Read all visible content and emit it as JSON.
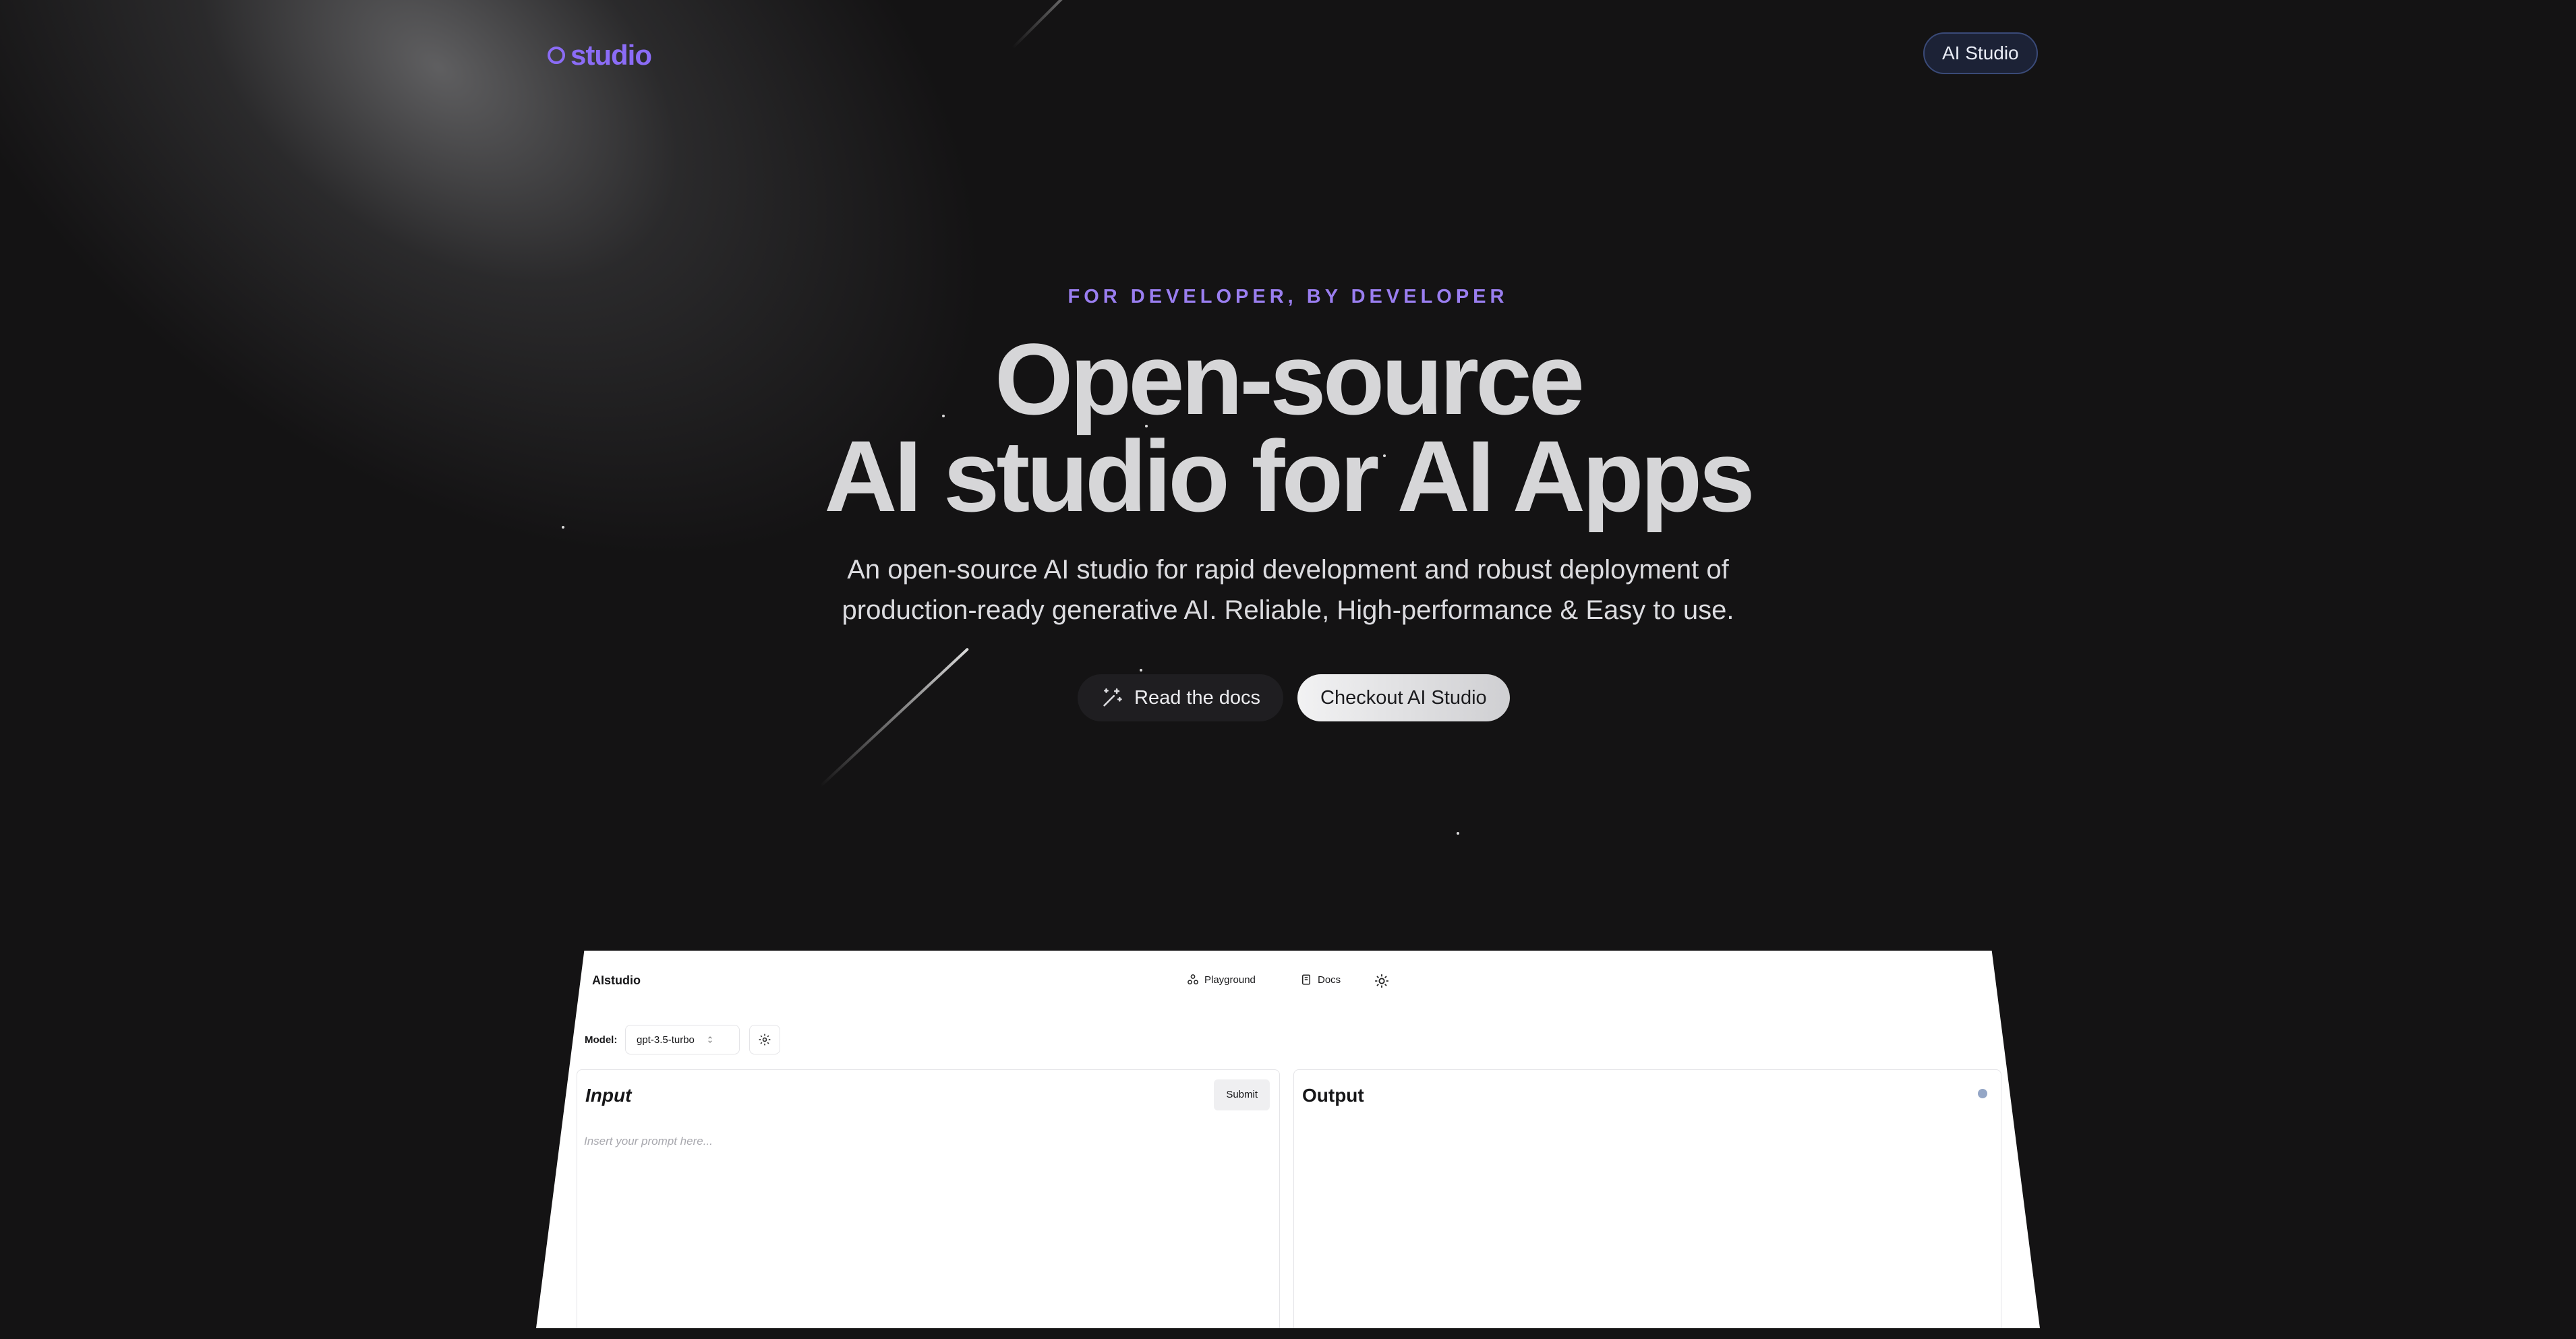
{
  "header": {
    "logo_text": "studio",
    "nav_button": "AI Studio"
  },
  "hero": {
    "eyebrow": "FOR DEVELOPER, BY DEVELOPER",
    "headline_line1": "Open-source",
    "headline_line2": "AI studio for AI Apps",
    "subhead_line1": "An open-source AI studio for rapid development and robust deployment of",
    "subhead_line2": "production-ready generative AI. Reliable, High-performance & Easy to use.",
    "docs_button": "Read the docs",
    "checkout_button": "Checkout AI Studio"
  },
  "preview": {
    "brand": "AIstudio",
    "nav_playground": "Playground",
    "nav_docs": "Docs",
    "model_label": "Model:",
    "model_value": "gpt-3.5-turbo",
    "input_title": "Input",
    "submit_label": "Submit",
    "input_placeholder": "Insert your prompt here...",
    "output_title": "Output"
  },
  "colors": {
    "accent": "#8b6cf6",
    "background": "#141314",
    "status_dot": "#94a6c6"
  }
}
